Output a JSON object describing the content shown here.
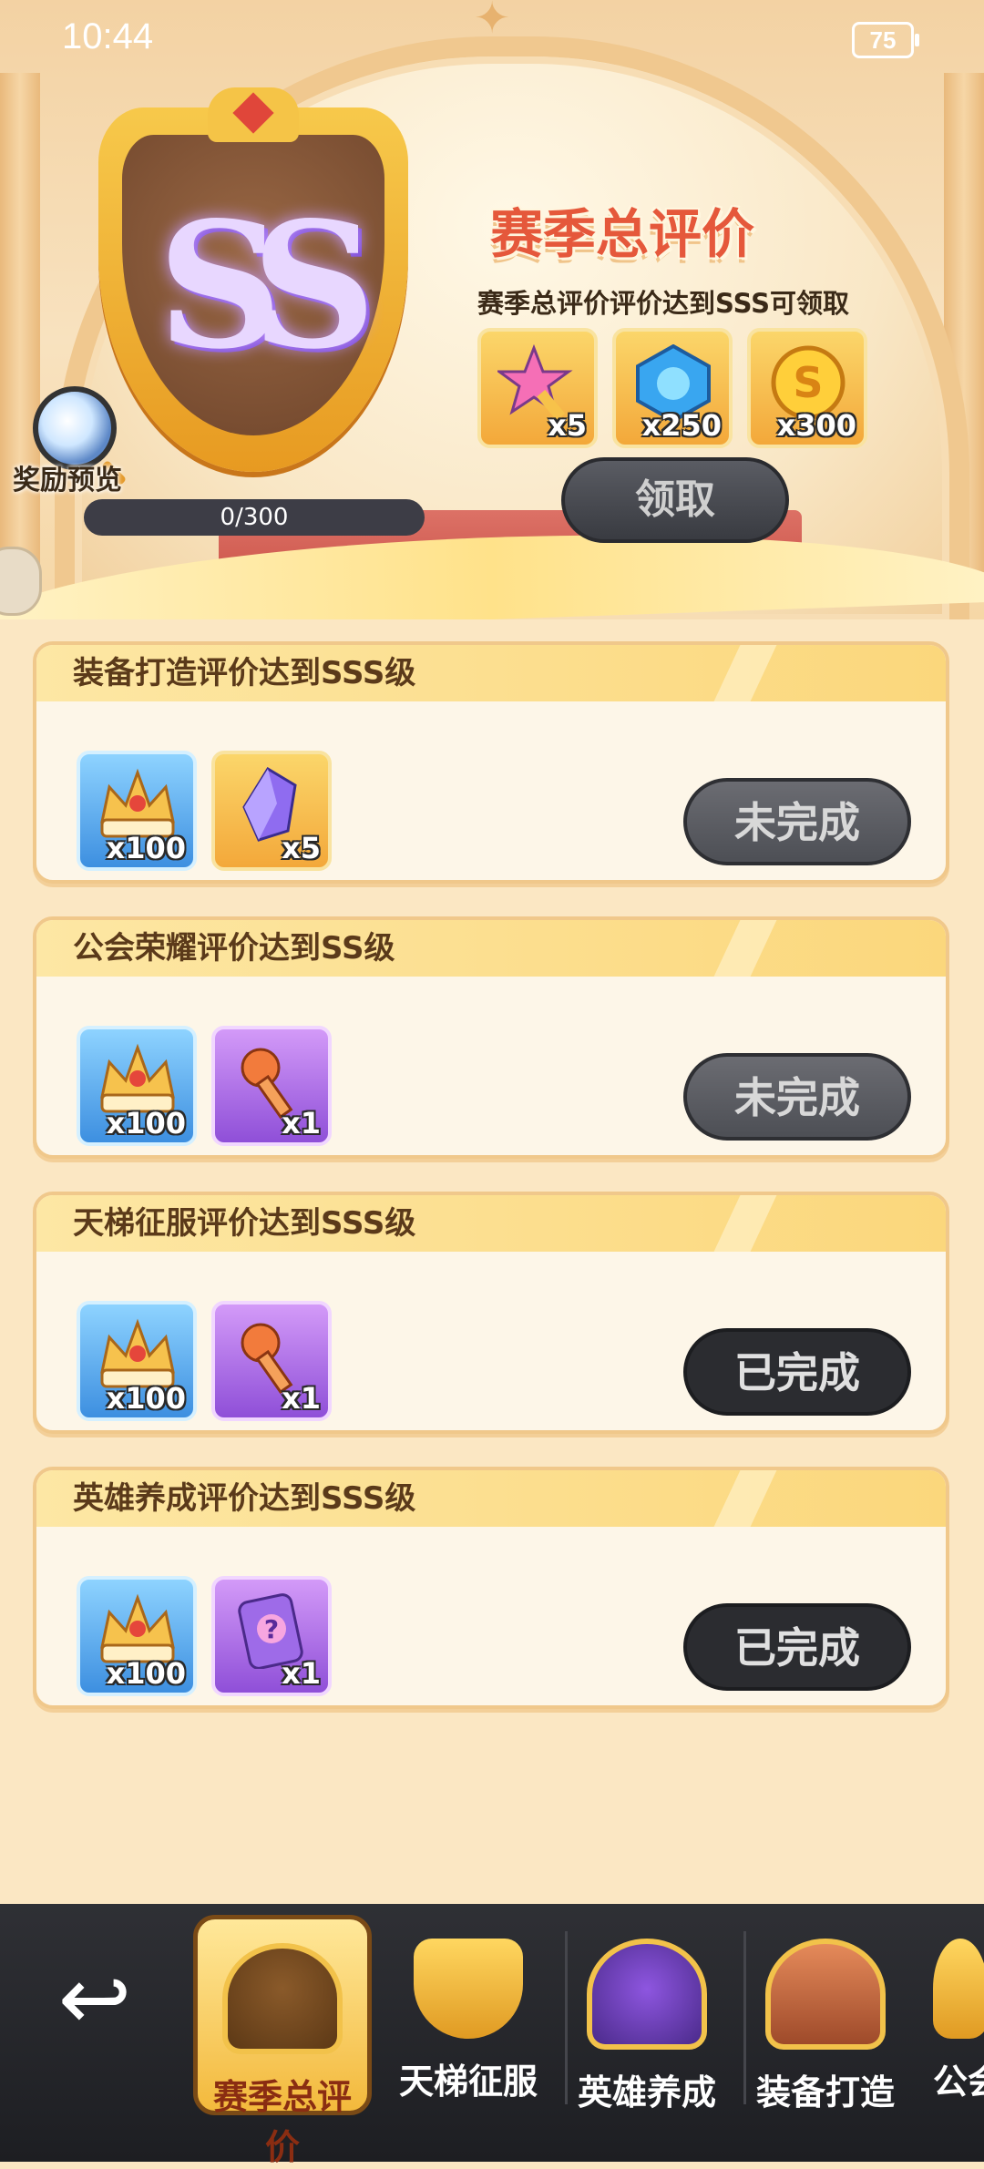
{
  "status_bar": {
    "time": "10:44",
    "battery": "75"
  },
  "header": {
    "rank_letters": "SS",
    "title": "赛季总评价",
    "subtitle": "赛季总评价评价达到SSS可领取",
    "preview_label": "奖励预览",
    "progress_text": "0/300",
    "claim_label": "领取",
    "rewards": [
      {
        "icon": "star-wand-icon",
        "qty": "x5"
      },
      {
        "icon": "blue-gem-icon",
        "qty": "x250"
      },
      {
        "icon": "gold-coin-icon",
        "qty": "x300"
      }
    ]
  },
  "tasks": [
    {
      "title": "装备打造评价达到SSS级",
      "status": "未完成",
      "rewards": [
        {
          "icon": "crown-icon",
          "qty": "x100"
        },
        {
          "icon": "crystal-icon",
          "qty": "x5"
        }
      ]
    },
    {
      "title": "公会荣耀评价达到SS级",
      "status": "未完成",
      "rewards": [
        {
          "icon": "crown-icon",
          "qty": "x100"
        },
        {
          "icon": "key-icon",
          "qty": "x1"
        }
      ]
    },
    {
      "title": "天梯征服评价达到SSS级",
      "status": "已完成",
      "rewards": [
        {
          "icon": "crown-icon",
          "qty": "x100"
        },
        {
          "icon": "key-icon",
          "qty": "x1"
        }
      ]
    },
    {
      "title": "英雄养成评价达到SSS级",
      "status": "已完成",
      "rewards": [
        {
          "icon": "crown-icon",
          "qty": "x100"
        },
        {
          "icon": "mystery-card-icon",
          "qty": "x1"
        }
      ]
    }
  ],
  "nav": {
    "tabs": [
      {
        "label": "赛季总评价",
        "icon": "season-crown-icon",
        "active": true
      },
      {
        "label": "天梯征服",
        "icon": "trophy-icon",
        "active": false
      },
      {
        "label": "英雄养成",
        "icon": "hero-helmet-icon",
        "active": false
      },
      {
        "label": "装备打造",
        "icon": "anvil-icon",
        "active": false
      },
      {
        "label": "公会",
        "icon": "guild-icon",
        "active": false
      }
    ]
  }
}
